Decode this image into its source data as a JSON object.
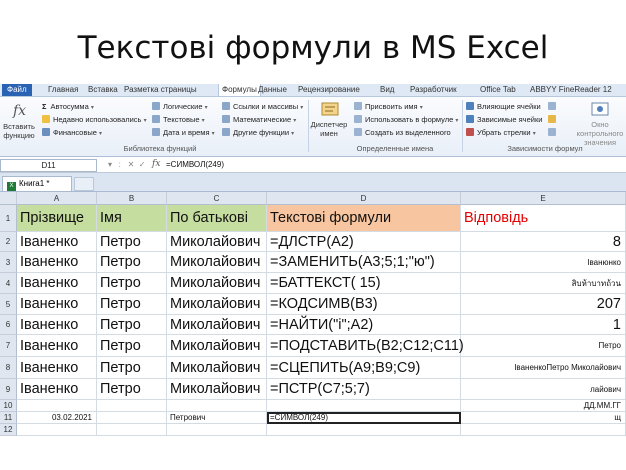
{
  "slide_title": "Текстові формули в MS Excel",
  "ribbon_tabs": [
    "Файл",
    "Главная",
    "Вставка",
    "Разметка страницы",
    "Формулы",
    "Данные",
    "Рецензирование",
    "Вид",
    "Разработчик",
    "Office Tab",
    "ABBYY FineReader 12"
  ],
  "ribbon": {
    "insert_function": "Вставить функцию",
    "autosum": "Автосумма",
    "recent": "Недавно использовались",
    "financial": "Финансовые",
    "logical": "Логические",
    "text": "Текстовые",
    "datetime": "Дата и время",
    "lookup": "Ссылки и массивы",
    "math": "Математические",
    "other": "Другие функции",
    "group_library": "Библиотека функций",
    "name_manager": "Диспетчер имен",
    "assign_name": "Присвоить имя",
    "use_in_formula": "Использовать в формуле",
    "create_from_selection": "Создать из выделенного",
    "group_names": "Определенные имена",
    "trace_precedents": "Влияющие ячейки",
    "trace_dependents": "Зависимые ячейки",
    "remove_arrows": "Убрать стрелки",
    "group_audit": "Зависимости формул",
    "watch_window": "Окно контрольного значения"
  },
  "formula_bar": {
    "name_box": "D11",
    "fx": "fx",
    "formula": "=СИМВОЛ(249)"
  },
  "workbook_tab": "Книга1 *",
  "columns": [
    "A",
    "B",
    "C",
    "D",
    "E"
  ],
  "rows": [
    {
      "num": "1",
      "A": "Прізвище",
      "B": "Імя",
      "C": "По батькові",
      "D": "Текстові формули",
      "E": "Відповідь"
    },
    {
      "num": "2",
      "A": "Іваненко",
      "B": "Петро",
      "C": "Миколайович",
      "D": "=ДЛСТР(A2)",
      "E": "8"
    },
    {
      "num": "3",
      "A": "Іваненко",
      "B": "Петро",
      "C": "Миколайович",
      "D": "=ЗАМЕНИТЬ(A3;5;1;\"ю\")",
      "E": "Іванюнко"
    },
    {
      "num": "4",
      "A": "Іваненко",
      "B": "Петро",
      "C": "Миколайович",
      "D": "=БАТТЕКСТ( 15)",
      "E": "สิบห้าบาทถ้วน"
    },
    {
      "num": "5",
      "A": "Іваненко",
      "B": "Петро",
      "C": "Миколайович",
      "D": "=КОДСИМВ(B3)",
      "E": "207"
    },
    {
      "num": "6",
      "A": "Іваненко",
      "B": "Петро",
      "C": "Миколайович",
      "D": "=НАЙТИ(\"і\";A2)",
      "E": "1"
    },
    {
      "num": "7",
      "A": "Іваненко",
      "B": "Петро",
      "C": "Миколайович",
      "D": "=ПОДСТАВИТЬ(B2;C12;C11)",
      "E": "Петро"
    },
    {
      "num": "8",
      "A": "Іваненко",
      "B": "Петро",
      "C": "Миколайович",
      "D": "=СЦЕПИТЬ(A9;B9;C9)",
      "E": "ІваненкоПетро Миколайович"
    },
    {
      "num": "9",
      "A": "Іваненко",
      "B": "Петро",
      "C": "Миколайович",
      "D": "=ПСТР(C7;5;7)",
      "E": "лайович"
    },
    {
      "num": "10",
      "A": "",
      "B": "",
      "C": "",
      "D": "",
      "E": "ДД.ММ.ГГ"
    },
    {
      "num": "11",
      "A": "03.02.2021",
      "B": "",
      "C": "Петрович",
      "D": "=СИМВОЛ(249)",
      "E": "щ"
    },
    {
      "num": "12",
      "A": "",
      "B": "",
      "C": "",
      "D": "",
      "E": ""
    }
  ],
  "colors": {
    "header_green": "#c5dd9e",
    "header_orange": "#f7c59f",
    "answer_red": "#e60000"
  }
}
